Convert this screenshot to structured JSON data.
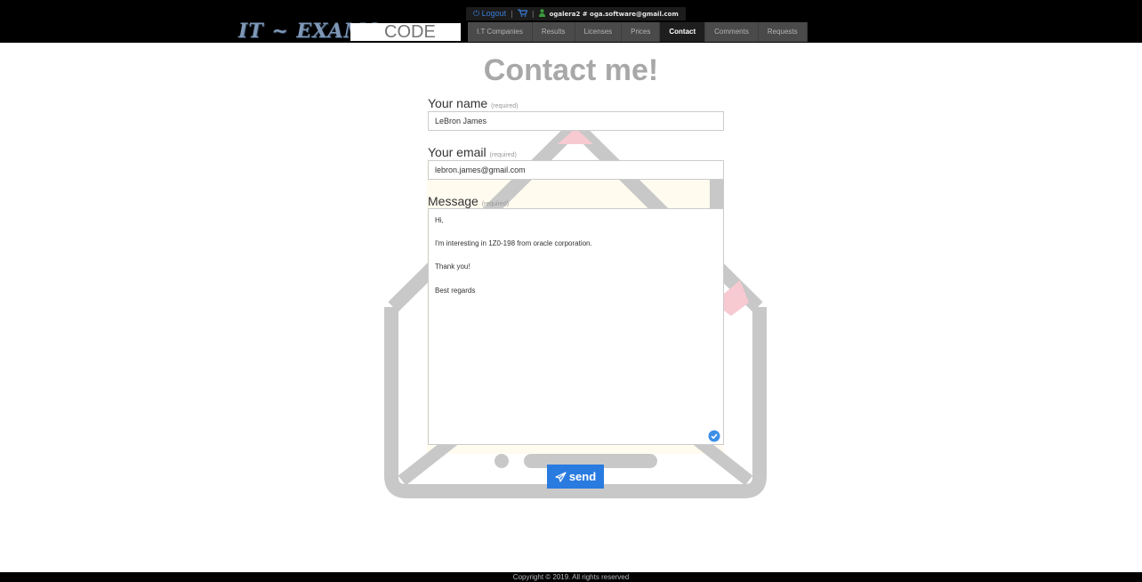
{
  "header": {
    "logout_label": "Logout",
    "separator": "|",
    "username": "ogalera2 # oga.software@gmail.com",
    "logo_text": "IT ~ EXAMS",
    "code_placeholder": "CODE"
  },
  "nav": {
    "items": [
      {
        "label": "I.T Companies"
      },
      {
        "label": "Results"
      },
      {
        "label": "Licenses"
      },
      {
        "label": "Prices"
      },
      {
        "label": "Contact",
        "active": true
      },
      {
        "label": "Comments"
      },
      {
        "label": "Requests"
      }
    ]
  },
  "form": {
    "title": "Contact me!",
    "required_note": "(required)",
    "name_label": "Your name",
    "name_value": "LeBron James",
    "email_label": "Your email",
    "email_value": "lebron.james@gmail.com",
    "message_label": "Message",
    "message_lines": [
      "Hi,",
      "I'm interesting in 1Z0-198 from oracle corporation.",
      "Thank you!",
      "Best regards"
    ],
    "send_label": "send"
  },
  "footer": {
    "copyright": "Copyright © 2019. All rights reserved"
  },
  "colors": {
    "accent": "#2a7be0",
    "nav_bg": "#4a4a4a",
    "nav_active_bg": "#1e1e1e",
    "envelope_gray": "#c8c8c8",
    "envelope_pink": "#f7c9d1"
  },
  "icons": [
    "logout-icon",
    "cart-icon",
    "user-icon",
    "paper-plane-icon",
    "check-circle-icon",
    "envelope-illustration"
  ]
}
